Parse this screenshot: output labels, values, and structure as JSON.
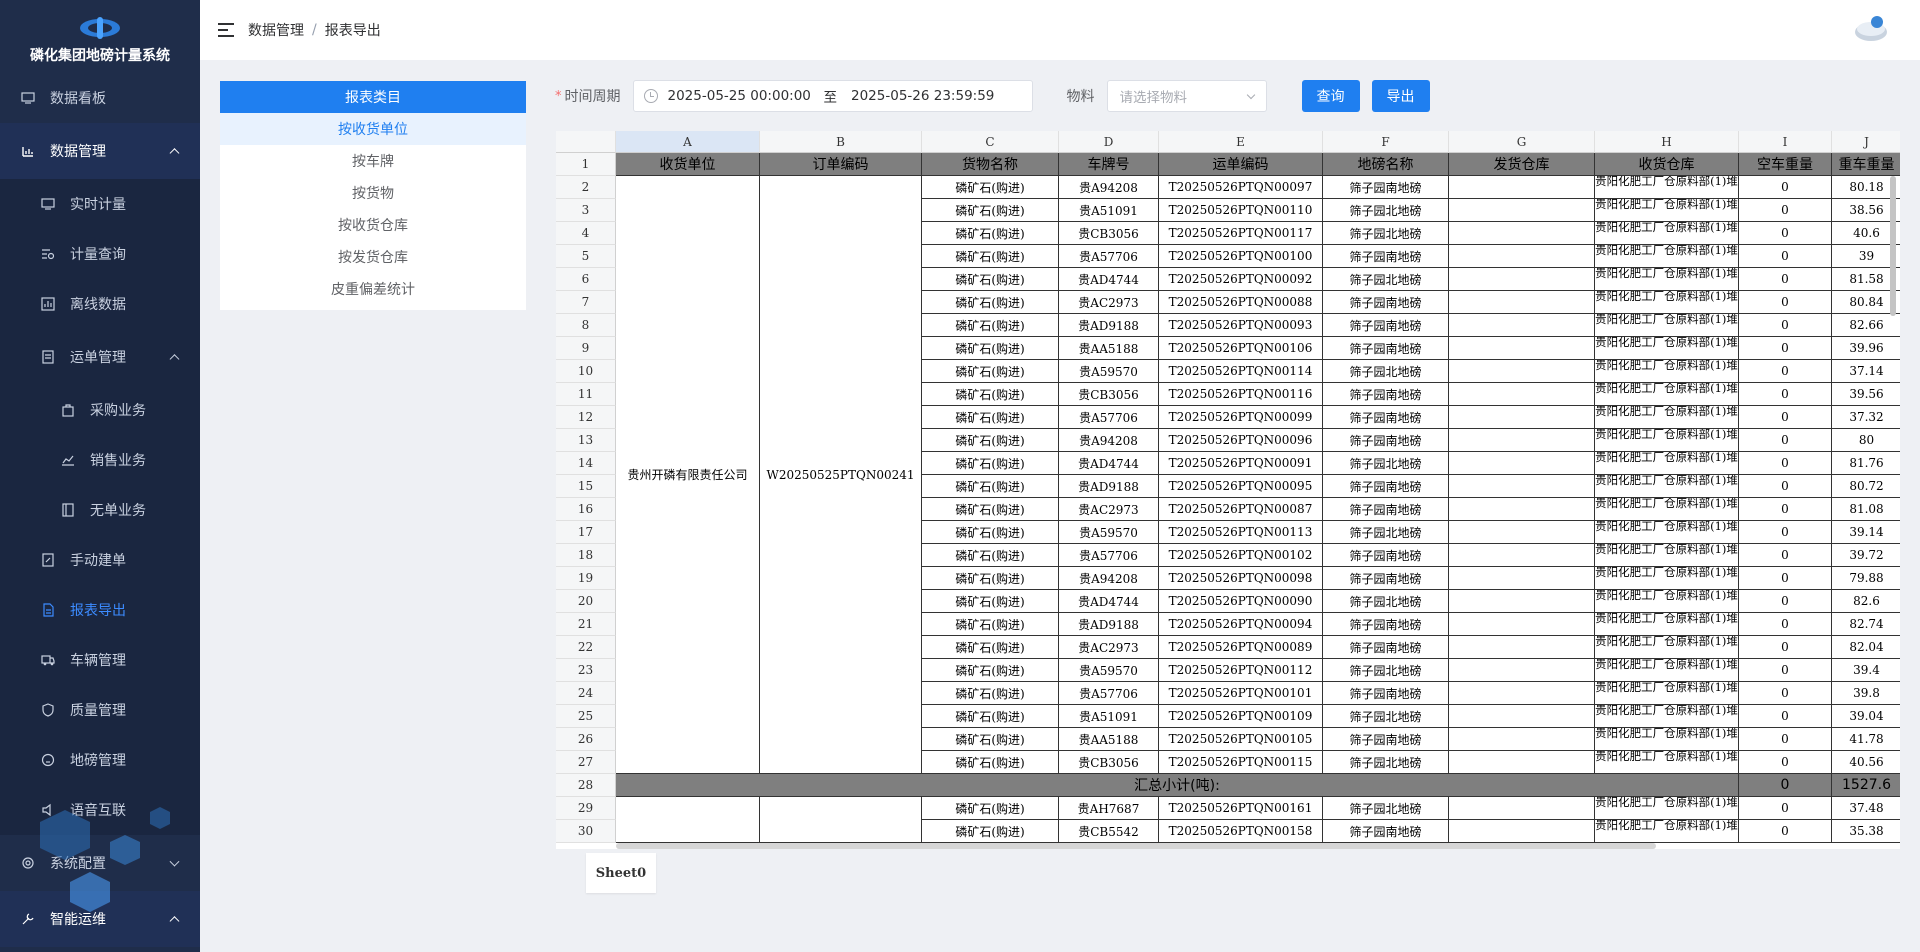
{
  "app": {
    "title": "磷化集团地磅计量系统"
  },
  "breadcrumb": [
    "数据管理",
    "报表导出"
  ],
  "sidebar": {
    "items": [
      {
        "label": "数据看板",
        "icon": "monitor-icon"
      },
      {
        "label": "数据管理",
        "icon": "bar-chart-icon"
      },
      {
        "label": "实时计量",
        "icon": "monitor-icon"
      },
      {
        "label": "计量查询",
        "icon": "search-list-icon"
      },
      {
        "label": "离线数据",
        "icon": "chart-icon"
      },
      {
        "label": "运单管理",
        "icon": "document-icon"
      },
      {
        "label": "采购业务",
        "icon": "bag-icon"
      },
      {
        "label": "销售业务",
        "icon": "trend-icon"
      },
      {
        "label": "无单业务",
        "icon": "notebook-icon"
      },
      {
        "label": "手动建单",
        "icon": "edit-doc-icon"
      },
      {
        "label": "报表导出",
        "icon": "file-icon"
      },
      {
        "label": "车辆管理",
        "icon": "truck-icon"
      },
      {
        "label": "质量管理",
        "icon": "shield-icon"
      },
      {
        "label": "地磅管理",
        "icon": "scale-icon"
      },
      {
        "label": "语音互联",
        "icon": "speaker-icon"
      },
      {
        "label": "系统配置",
        "icon": "gear-icon"
      },
      {
        "label": "智能运维",
        "icon": "tools-icon"
      }
    ]
  },
  "report_panel": {
    "title": "报表类目",
    "items": [
      "按收货单位",
      "按车牌",
      "按货物",
      "按收货仓库",
      "按发货仓库",
      "皮重偏差统计"
    ]
  },
  "filters": {
    "period_label": "时间周期",
    "required_mark": "*",
    "start": "2025-05-25 00:00:00",
    "to": "至",
    "end": "2025-05-26 23:59:59",
    "material_label": "物料",
    "material_placeholder": "请选择物料",
    "query_label": "查询",
    "export_label": "导出"
  },
  "sheet": {
    "tab": "Sheet0",
    "columns": [
      "A",
      "B",
      "C",
      "D",
      "E",
      "F",
      "G",
      "H",
      "I",
      "J"
    ],
    "headers": [
      "收货单位",
      "订单编码",
      "货物名称",
      "车牌号",
      "运单编码",
      "地磅名称",
      "发货仓库",
      "收货仓库",
      "空车重量",
      "重车重量"
    ],
    "merged_unit": "贵州开磷有限责任公司",
    "merged_order": "W20250525PTQN00241",
    "warehouse_line1": "贵阳化肥工厂仓原料部",
    "warehouse_line2": "(1)堆",
    "goods": "磷矿石(购进)",
    "rows": [
      {
        "n": "2",
        "plate": "贵A94208",
        "waybill": "T20250526PTQN00097",
        "scale": "筛子园南地磅",
        "empty": "0",
        "heavy": "80.18"
      },
      {
        "n": "3",
        "plate": "贵A51091",
        "waybill": "T20250526PTQN00110",
        "scale": "筛子园北地磅",
        "empty": "0",
        "heavy": "38.56"
      },
      {
        "n": "4",
        "plate": "贵CB3056",
        "waybill": "T20250526PTQN00117",
        "scale": "筛子园北地磅",
        "empty": "0",
        "heavy": "40.6"
      },
      {
        "n": "5",
        "plate": "贵A57706",
        "waybill": "T20250526PTQN00100",
        "scale": "筛子园南地磅",
        "empty": "0",
        "heavy": "39"
      },
      {
        "n": "6",
        "plate": "贵AD4744",
        "waybill": "T20250526PTQN00092",
        "scale": "筛子园北地磅",
        "empty": "0",
        "heavy": "81.58"
      },
      {
        "n": "7",
        "plate": "贵AC2973",
        "waybill": "T20250526PTQN00088",
        "scale": "筛子园南地磅",
        "empty": "0",
        "heavy": "80.84"
      },
      {
        "n": "8",
        "plate": "贵AD9188",
        "waybill": "T20250526PTQN00093",
        "scale": "筛子园南地磅",
        "empty": "0",
        "heavy": "82.66"
      },
      {
        "n": "9",
        "plate": "贵AA5188",
        "waybill": "T20250526PTQN00106",
        "scale": "筛子园南地磅",
        "empty": "0",
        "heavy": "39.96"
      },
      {
        "n": "10",
        "plate": "贵A59570",
        "waybill": "T20250526PTQN00114",
        "scale": "筛子园北地磅",
        "empty": "0",
        "heavy": "37.14"
      },
      {
        "n": "11",
        "plate": "贵CB3056",
        "waybill": "T20250526PTQN00116",
        "scale": "筛子园南地磅",
        "empty": "0",
        "heavy": "39.56"
      },
      {
        "n": "12",
        "plate": "贵A57706",
        "waybill": "T20250526PTQN00099",
        "scale": "筛子园南地磅",
        "empty": "0",
        "heavy": "37.32"
      },
      {
        "n": "13",
        "plate": "贵A94208",
        "waybill": "T20250526PTQN00096",
        "scale": "筛子园南地磅",
        "empty": "0",
        "heavy": "80"
      },
      {
        "n": "14",
        "plate": "贵AD4744",
        "waybill": "T20250526PTQN00091",
        "scale": "筛子园北地磅",
        "empty": "0",
        "heavy": "81.76"
      },
      {
        "n": "15",
        "plate": "贵AD9188",
        "waybill": "T20250526PTQN00095",
        "scale": "筛子园南地磅",
        "empty": "0",
        "heavy": "80.72"
      },
      {
        "n": "16",
        "plate": "贵AC2973",
        "waybill": "T20250526PTQN00087",
        "scale": "筛子园南地磅",
        "empty": "0",
        "heavy": "81.08"
      },
      {
        "n": "17",
        "plate": "贵A59570",
        "waybill": "T20250526PTQN00113",
        "scale": "筛子园北地磅",
        "empty": "0",
        "heavy": "39.14"
      },
      {
        "n": "18",
        "plate": "贵A57706",
        "waybill": "T20250526PTQN00102",
        "scale": "筛子园南地磅",
        "empty": "0",
        "heavy": "39.72"
      },
      {
        "n": "19",
        "plate": "贵A94208",
        "waybill": "T20250526PTQN00098",
        "scale": "筛子园南地磅",
        "empty": "0",
        "heavy": "79.88"
      },
      {
        "n": "20",
        "plate": "贵AD4744",
        "waybill": "T20250526PTQN00090",
        "scale": "筛子园北地磅",
        "empty": "0",
        "heavy": "82.6"
      },
      {
        "n": "21",
        "plate": "贵AD9188",
        "waybill": "T20250526PTQN00094",
        "scale": "筛子园南地磅",
        "empty": "0",
        "heavy": "82.74"
      },
      {
        "n": "22",
        "plate": "贵AC2973",
        "waybill": "T20250526PTQN00089",
        "scale": "筛子园南地磅",
        "empty": "0",
        "heavy": "82.04"
      },
      {
        "n": "23",
        "plate": "贵A59570",
        "waybill": "T20250526PTQN00112",
        "scale": "筛子园北地磅",
        "empty": "0",
        "heavy": "39.4"
      },
      {
        "n": "24",
        "plate": "贵A57706",
        "waybill": "T20250526PTQN00101",
        "scale": "筛子园南地磅",
        "empty": "0",
        "heavy": "39.8"
      },
      {
        "n": "25",
        "plate": "贵A51091",
        "waybill": "T20250526PTQN00109",
        "scale": "筛子园北地磅",
        "empty": "0",
        "heavy": "39.04"
      },
      {
        "n": "26",
        "plate": "贵AA5188",
        "waybill": "T20250526PTQN00105",
        "scale": "筛子园南地磅",
        "empty": "0",
        "heavy": "41.78"
      },
      {
        "n": "27",
        "plate": "贵CB3056",
        "waybill": "T20250526PTQN00115",
        "scale": "筛子园北地磅",
        "empty": "0",
        "heavy": "40.56"
      }
    ],
    "total_row": {
      "n": "28",
      "label": "汇总小计(吨):",
      "empty": "0",
      "heavy": "1527.6"
    },
    "rows_after": [
      {
        "n": "29",
        "plate": "贵AH7687",
        "waybill": "T20250526PTQN00161",
        "scale": "筛子园北地磅",
        "empty": "0",
        "heavy": "37.48"
      },
      {
        "n": "30",
        "plate": "贵CB5542",
        "waybill": "T20250526PTQN00158",
        "scale": "筛子园南地磅",
        "empty": "0",
        "heavy": "35.38"
      }
    ]
  },
  "colors": {
    "primary": "#1f7ff0",
    "sidebar_bg": "#1f2d4a",
    "header_cell_bg": "#7f7f7f"
  }
}
